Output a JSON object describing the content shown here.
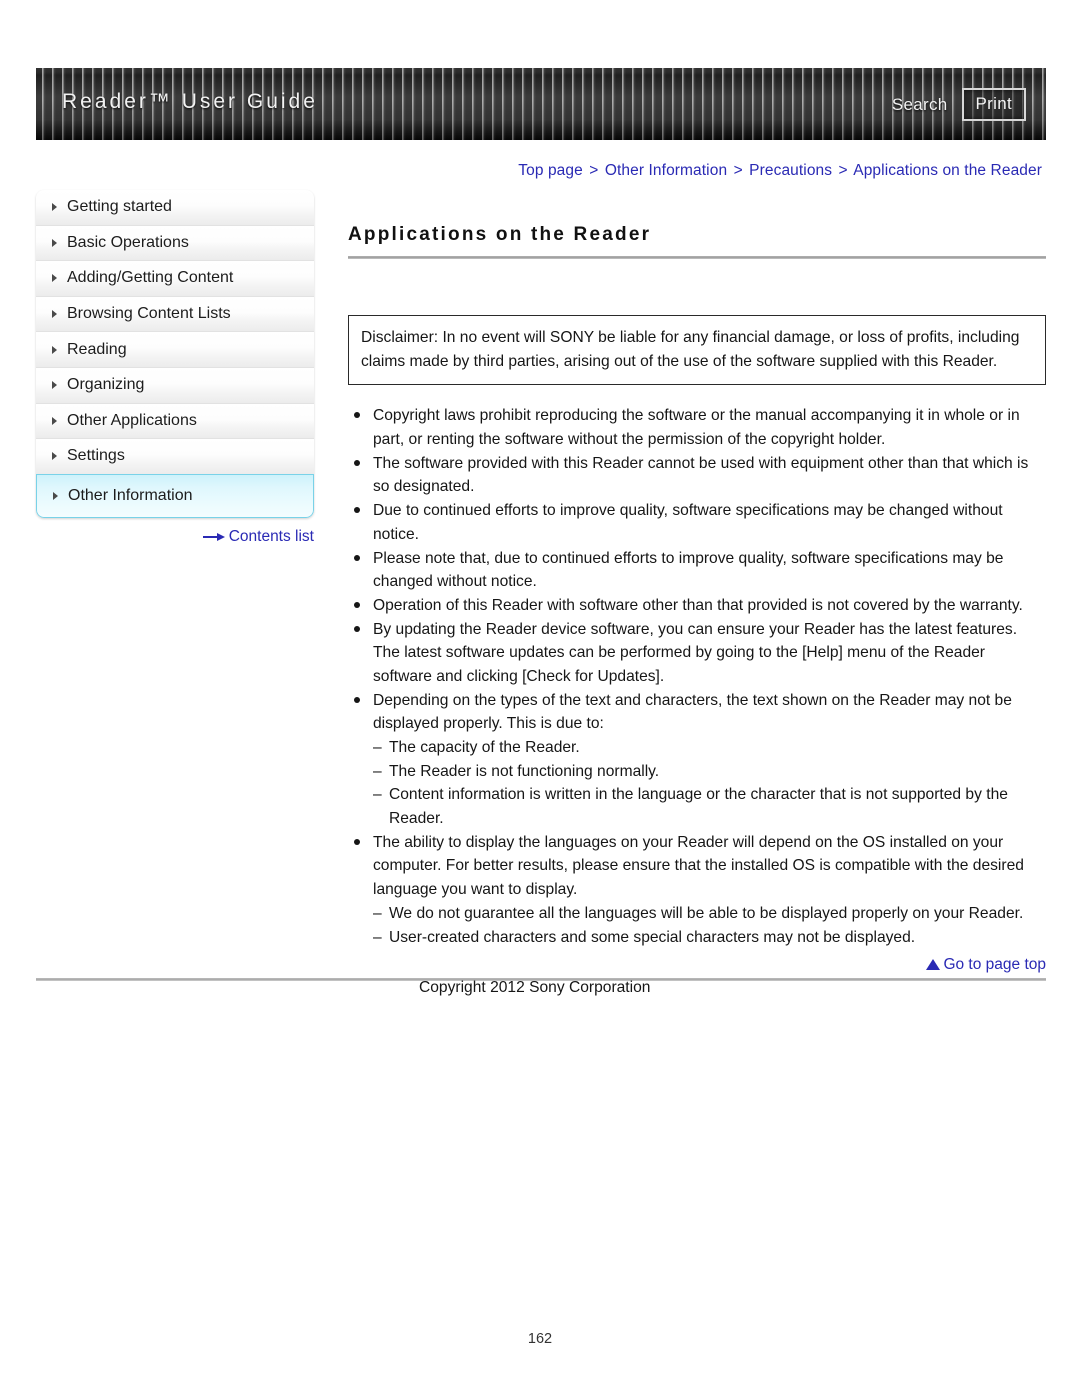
{
  "header": {
    "title": "Reader™ User Guide",
    "search_label": "Search",
    "print_label": "Print"
  },
  "breadcrumb": {
    "items": [
      "Top page",
      "Other Information",
      "Precautions",
      "Applications on the Reader"
    ],
    "separator": ">"
  },
  "sidebar": {
    "items": [
      {
        "label": "Getting started",
        "active": false
      },
      {
        "label": "Basic Operations",
        "active": false
      },
      {
        "label": "Adding/Getting Content",
        "active": false
      },
      {
        "label": "Browsing Content Lists",
        "active": false
      },
      {
        "label": "Reading",
        "active": false
      },
      {
        "label": "Organizing",
        "active": false
      },
      {
        "label": "Other Applications",
        "active": false
      },
      {
        "label": "Settings",
        "active": false
      },
      {
        "label": "Other Information",
        "active": true
      }
    ],
    "contents_list_label": "Contents list"
  },
  "main": {
    "page_title": "Applications on the Reader",
    "disclaimer": "Disclaimer: In no event will SONY be liable for any financial damage, or loss of profits, including claims made by third parties, arising out of the use of the software supplied with this Reader.",
    "bullets": [
      {
        "text": "Copyright laws prohibit reproducing the software or the manual accompanying it in whole or in part, or renting the software without the permission of the copyright holder.",
        "subitems": []
      },
      {
        "text": "The software provided with this Reader cannot be used with equipment other than that which is so designated.",
        "subitems": []
      },
      {
        "text": "Due to continued efforts to improve quality, software specifications may be changed without notice.",
        "subitems": []
      },
      {
        "text": "Please note that, due to continued efforts to improve quality, software specifications may be changed without notice.",
        "subitems": []
      },
      {
        "text": "Operation of this Reader with software other than that provided is not covered by the warranty.",
        "subitems": []
      },
      {
        "text": "By updating the Reader device software, you can ensure your Reader has the latest features. The latest software updates can be performed by going to the [Help] menu of the Reader software and clicking [Check for Updates].",
        "subitems": []
      },
      {
        "text": "Depending on the types of the text and characters, the text shown on the Reader may not be displayed properly. This is due to:",
        "subitems": [
          "The capacity of the Reader.",
          "The Reader is not functioning normally.",
          "Content information is written in the language or the character that is not supported by the Reader."
        ]
      },
      {
        "text": "The ability to display the languages on your Reader will depend on the OS installed on your computer. For better results, please ensure that the installed OS is compatible with the desired language you want to display.",
        "subitems": [
          "We do not guarantee all the languages will be able to be displayed properly on your Reader.",
          "User-created characters and some special characters may not be displayed."
        ]
      }
    ],
    "subitem_dash": "–"
  },
  "footer": {
    "goto_top_label": "Go to page top",
    "copyright": "Copyright 2012 Sony Corporation",
    "page_number": "162"
  }
}
